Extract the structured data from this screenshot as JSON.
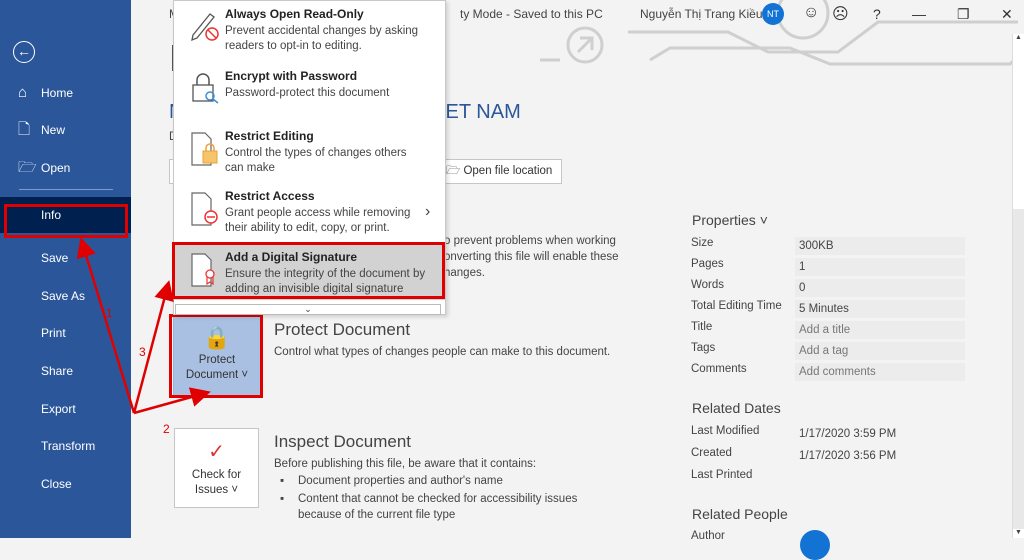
{
  "titlebar": {
    "left_fragment": "M",
    "right_fragment": "ty Mode  -  Saved to this PC",
    "user_name": "Nguyễn Thị Trang Kiều",
    "user_initials": "NT",
    "help": "?",
    "minimize": "—",
    "restore": "❐",
    "close": "✕"
  },
  "sidebar": {
    "back": "←",
    "items": [
      {
        "label": "Home",
        "icon": "⌂"
      },
      {
        "label": "New",
        "icon": "🗋"
      },
      {
        "label": "Open",
        "icon": "🗁"
      },
      {
        "label": "Info"
      },
      {
        "label": "Save"
      },
      {
        "label": "Save As"
      },
      {
        "label": "Print"
      },
      {
        "label": "Share"
      },
      {
        "label": "Export"
      },
      {
        "label": "Transform"
      },
      {
        "label": "Close"
      }
    ],
    "active": "Info"
  },
  "doc": {
    "heading_left": "N",
    "heading_right": "IET NAM",
    "sub_fragment": "D"
  },
  "open_file_location": "Open file location",
  "compat_fragments": [
    "o prevent problems when working",
    "onverting this file will enable these",
    "hanges."
  ],
  "protect_menu": {
    "items": [
      {
        "title": "Always Open Read-Only",
        "desc": "Prevent accidental changes by asking readers to opt-in to editing."
      },
      {
        "title": "Encrypt with Password",
        "desc": "Password-protect this document"
      },
      {
        "title": "Restrict Editing",
        "desc": "Control the types of changes others can make"
      },
      {
        "title": "Restrict Access",
        "desc": "Grant people access while removing their ability to edit, copy, or print.",
        "submenu": "›"
      },
      {
        "title": "Add a Digital Signature",
        "desc": "Ensure the integrity of the document by adding an invisible digital signature",
        "highlighted": true
      }
    ],
    "more": "⌄"
  },
  "protect": {
    "button": "Protect Document ˅",
    "title": "Protect Document",
    "desc": "Control what types of changes people can make to this document."
  },
  "inspect": {
    "button": "Check for Issues ˅",
    "title": "Inspect Document",
    "desc": "Before publishing this file, be aware that it contains:",
    "bullets": [
      "Document properties and author's name",
      "Content that cannot be checked for accessibility issues because of the current file type"
    ]
  },
  "properties": {
    "title": "Properties ˅",
    "rows": [
      {
        "label": "Size",
        "value": "300KB"
      },
      {
        "label": "Pages",
        "value": "1"
      },
      {
        "label": "Words",
        "value": "0"
      },
      {
        "label": "Total Editing Time",
        "value": "5 Minutes"
      },
      {
        "label": "Title",
        "value": "Add a title"
      },
      {
        "label": "Tags",
        "value": "Add a tag"
      },
      {
        "label": "Comments",
        "value": "Add comments"
      }
    ]
  },
  "related_dates": {
    "title": "Related Dates",
    "rows": [
      {
        "label": "Last Modified",
        "value": "1/17/2020 3:59 PM"
      },
      {
        "label": "Created",
        "value": "1/17/2020 3:56 PM"
      },
      {
        "label": "Last Printed",
        "value": ""
      }
    ]
  },
  "related_people": {
    "title": "Related People",
    "author_label": "Author"
  },
  "annotations": [
    "1",
    "2",
    "3"
  ],
  "colors": {
    "sidebar": "#2b579a",
    "active": "#002050",
    "highlight": "#e00000",
    "protect_button": "#a9c0e2"
  }
}
